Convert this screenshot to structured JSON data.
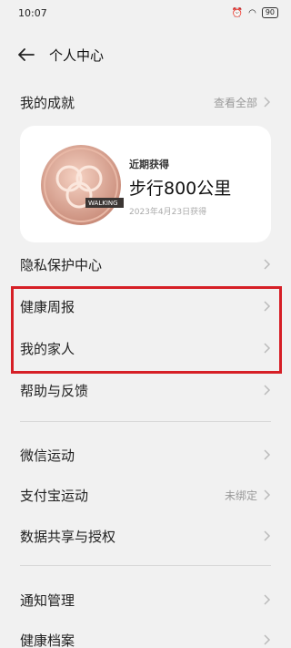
{
  "status_bar": {
    "time": "10:07",
    "battery": "90"
  },
  "header": {
    "title": "个人中心"
  },
  "achievements": {
    "label": "我的成就",
    "view_all": "查看全部",
    "card": {
      "subtitle": "近期获得",
      "title": "步行800公里",
      "date": "2023年4月23日获得",
      "badge_text": "WALKING"
    }
  },
  "menu": {
    "privacy": "隐私保护中心",
    "health_report": "健康周报",
    "family": "我的家人",
    "help": "帮助与反馈",
    "wechat": "微信运动",
    "alipay": "支付宝运动",
    "alipay_status": "未绑定",
    "data_share": "数据共享与授权",
    "notifications": "通知管理",
    "health_record": "健康档案"
  },
  "colors": {
    "highlight": "#d61f26",
    "background": "#f1f1f1"
  }
}
